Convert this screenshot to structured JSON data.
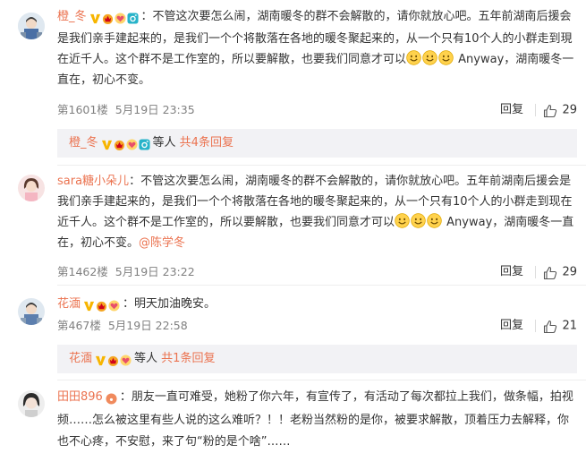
{
  "comments": [
    {
      "username": "橙_冬",
      "text_1": "：不管这次要怎么闹，湖南暖冬的群不会解散的，请你就放心吧。五年前湖南后援会是我们亲手建起来的，是我们一个个将散落在各地的暖冬聚起来的，从一个只有10个人的小群走到現在近千人。这个群不是工作室的，所以要解散，也要我们同意才可以",
      "text_2": " Anyway，湖南暖冬一直在，初心不变。",
      "floor": "第1601楼",
      "date": "5月19日 23:35",
      "reply_label": "回复",
      "likes": "29",
      "sub_user": "橙_冬",
      "sub_text_1": "等人",
      "sub_link": "共4条回复"
    },
    {
      "username": "sara糖小朵儿",
      "text_1": "：不管这次要怎么闹，湖南暖冬的群不会解散的，请你就放心吧。五年前湖南后援会是我们亲手建起来的，是我们一个个将散落在各地的暖冬聚起来的，从一个只有10个人的小群走到现在近千人。这个群不是工作室的，所以要解散，也要我们同意才可以",
      "text_2": " Anyway，湖南暖冬一直在，初心不变。",
      "mention": "@陈学冬",
      "floor": "第1462楼",
      "date": "5月19日 23:22",
      "reply_label": "回复",
      "likes": "29"
    },
    {
      "username": "花湎",
      "text_1": "：明天加油晚安。",
      "floor": "第467楼",
      "date": "5月19日 22:58",
      "reply_label": "回复",
      "likes": "21",
      "sub_user": "花湎",
      "sub_text_1": "等人",
      "sub_link": "共1条回复"
    },
    {
      "username": "田田896",
      "text_1": "：朋友一直可难受，她粉了你六年，有宣传了，有活动了每次都拉上我们，做条幅，拍视频……怎么被这里有些人说的这么难听？！！老粉当然粉的是你，被要求解散，顶着压力去解释，你也不心疼，不安慰，来了句“粉的是个啥”……"
    }
  ],
  "colors": {
    "accent": "#eb7350",
    "text": "#333333",
    "meta": "#808080",
    "subbox_bg": "#f2f2f5"
  },
  "icons": [
    "vip-v-icon",
    "crown-badge-icon",
    "heart-badge-icon",
    "camera-badge-icon",
    "smile-emoji-icon",
    "thumbs-up-icon"
  ]
}
